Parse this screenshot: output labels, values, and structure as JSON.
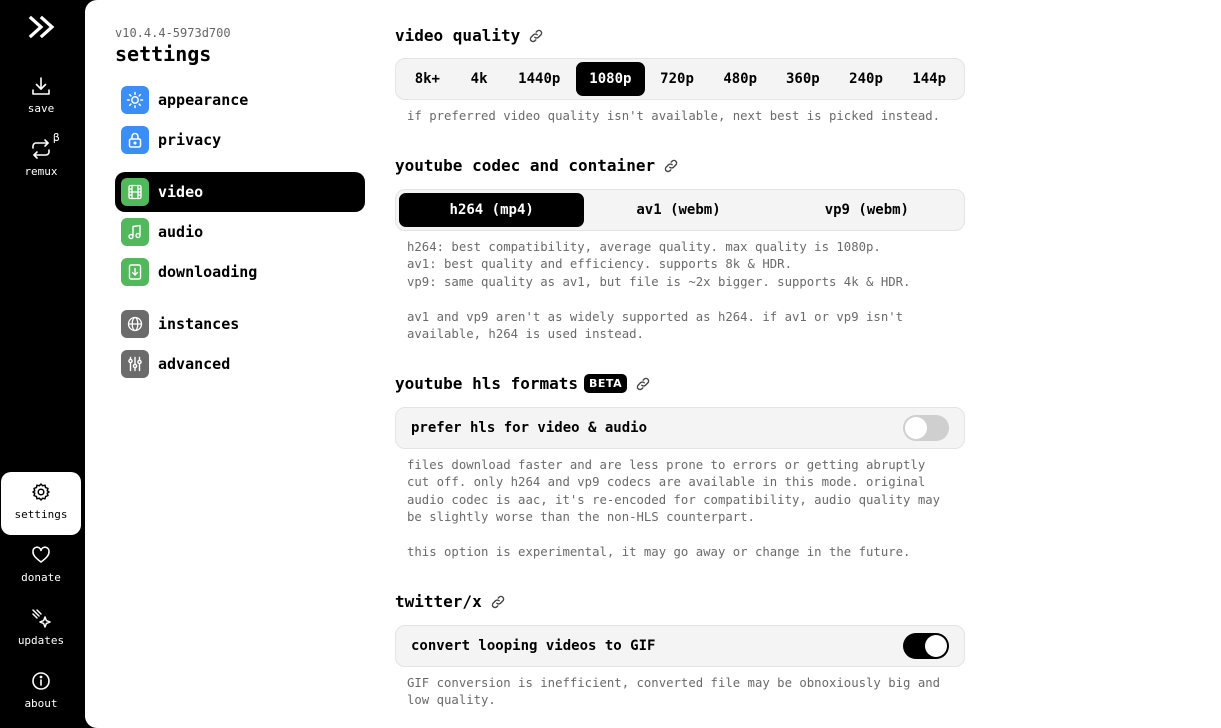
{
  "rail": {
    "items": [
      {
        "label": "save",
        "icon": "download-icon"
      },
      {
        "label": "remux",
        "icon": "remux-icon",
        "badge": "β"
      },
      {
        "label": "settings",
        "icon": "gear-icon"
      },
      {
        "label": "donate",
        "icon": "heart-icon"
      },
      {
        "label": "updates",
        "icon": "sparkles-icon"
      },
      {
        "label": "about",
        "icon": "info-icon"
      }
    ]
  },
  "settings": {
    "version": "v10.4.4-5973d700",
    "title": "settings",
    "nav": [
      {
        "label": "appearance",
        "icon": "sun-icon",
        "color": "#3a8ef6"
      },
      {
        "label": "privacy",
        "icon": "lock-icon",
        "color": "#3a8ef6"
      },
      {
        "label": "video",
        "icon": "film-icon",
        "color": "#52b85c"
      },
      {
        "label": "audio",
        "icon": "music-icon",
        "color": "#52b85c"
      },
      {
        "label": "downloading",
        "icon": "file-download-icon",
        "color": "#52b85c"
      },
      {
        "label": "instances",
        "icon": "globe-icon",
        "color": "#6b6b6b"
      },
      {
        "label": "advanced",
        "icon": "sliders-icon",
        "color": "#6b6b6b"
      }
    ]
  },
  "video_quality": {
    "title": "video quality",
    "options": [
      "8k+",
      "4k",
      "1440p",
      "1080p",
      "720p",
      "480p",
      "360p",
      "240p",
      "144p"
    ],
    "selected": "1080p",
    "description": "if preferred video quality isn't available, next best is picked instead."
  },
  "codec": {
    "title": "youtube codec and container",
    "options": [
      "h264 (mp4)",
      "av1 (webm)",
      "vp9 (webm)"
    ],
    "selected": "h264 (mp4)",
    "description": "h264: best compatibility, average quality. max quality is 1080p.\nav1: best quality and efficiency. supports 8k & HDR.\nvp9: same quality as av1, but file is ~2x bigger. supports 4k & HDR.\n\nav1 and vp9 aren't as widely supported as h264. if av1 or vp9 isn't\navailable, h264 is used instead."
  },
  "hls": {
    "title": "youtube hls formats",
    "badge": "BETA",
    "toggle_label": "prefer hls for video & audio",
    "enabled": false,
    "description": "files download faster and are less prone to errors or getting abruptly\ncut off. only h264 and vp9 codecs are available in this mode. original\naudio codec is aac, it's re-encoded for compatibility, audio quality may\nbe slightly worse than the non-HLS counterpart.\n\nthis option is experimental, it may go away or change in the future."
  },
  "twitter": {
    "title": "twitter/x",
    "toggle_label": "convert looping videos to GIF",
    "enabled": true,
    "description": "GIF conversion is inefficient, converted file may be obnoxiously big and\nlow quality."
  }
}
